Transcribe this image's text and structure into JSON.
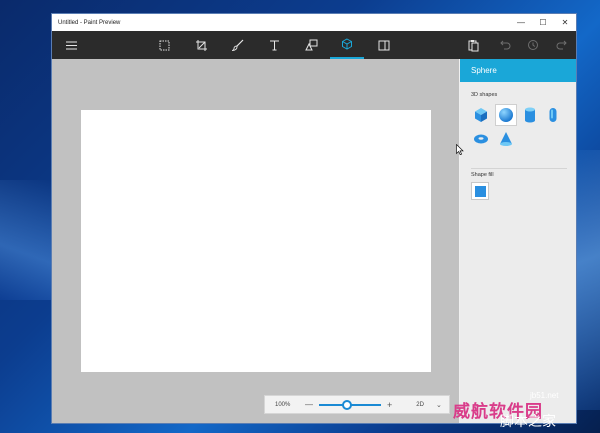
{
  "window": {
    "title": "Untitled - Paint Preview"
  },
  "window_controls": {
    "minimize": "—",
    "maximize": "☐",
    "close": "✕"
  },
  "toolbar": {
    "tools": [
      {
        "icon": "hamburger-menu-icon"
      },
      {
        "icon": "select-icon"
      },
      {
        "icon": "crop-icon"
      },
      {
        "icon": "brush-icon"
      },
      {
        "icon": "text-tool-icon"
      },
      {
        "icon": "2d-shapes-icon"
      },
      {
        "icon": "3d-objects-icon",
        "active": true
      },
      {
        "icon": "stickers-icon"
      },
      {
        "icon": "paste-icon"
      },
      {
        "icon": "undo-icon"
      },
      {
        "icon": "history-icon"
      },
      {
        "icon": "redo-icon"
      }
    ],
    "accent": "#1aa7d8"
  },
  "panel": {
    "title": "Sphere",
    "shapes_label": "3D shapes",
    "shapes": [
      "cube",
      "sphere",
      "cylinder",
      "capsule",
      "donut",
      "cone"
    ],
    "selected_shape": "sphere",
    "fill_label": "Shape fill",
    "fill_color": "#2a8fe0"
  },
  "zoom": {
    "percent": "100%",
    "minus": "—",
    "plus": "+",
    "level": 0.45,
    "view_mode": "2D",
    "chevron": "⌄"
  },
  "watermark": {
    "brand": "威航软件园",
    "site": "jb51.net",
    "chinese": "脚本之家"
  }
}
